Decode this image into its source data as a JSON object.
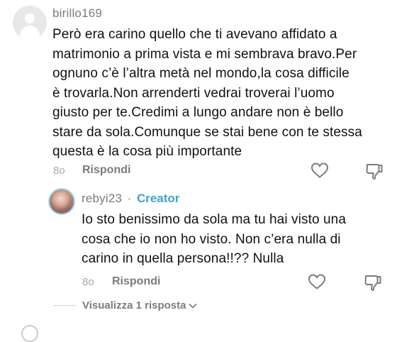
{
  "comment": {
    "username": "birillo169",
    "text_lines": [
      "Però era carino quello che ti avevano affidato a",
      "matrimonio a prima vista e mi sembrava bravo.Per",
      "ognuno c’è l’altra metà nel mondo,la cosa difficile",
      "è trovarla.Non arrenderti vedrai troverai l’uomo",
      "giusto per te.Credimi a lungo andare non è bello",
      "stare da sola.Comunque se stai bene con te stessa",
      "questa è la cosa più importante"
    ],
    "time": "8o",
    "reply_label": "Rispondi",
    "like_icon": "heart-outline-icon",
    "dislike_icon": "thumbs-down-icon"
  },
  "reply": {
    "username": "rebyi23",
    "separator": "·",
    "badge": "Creator",
    "text_lines": [
      "Io sto benissimo da sola ma tu hai visto una",
      "cosa che io non ho visto. Non c’era nulla di",
      "carino in quella persona!!?? Nulla"
    ],
    "time": "8o",
    "reply_label": "Rispondi"
  },
  "thread": {
    "view_replies_label": "Visualizza 1 risposta",
    "chevron_icon": "chevron-down-icon"
  },
  "colors": {
    "accent": "#3ba6c9",
    "muted": "#7b7b80",
    "text": "#111111"
  }
}
